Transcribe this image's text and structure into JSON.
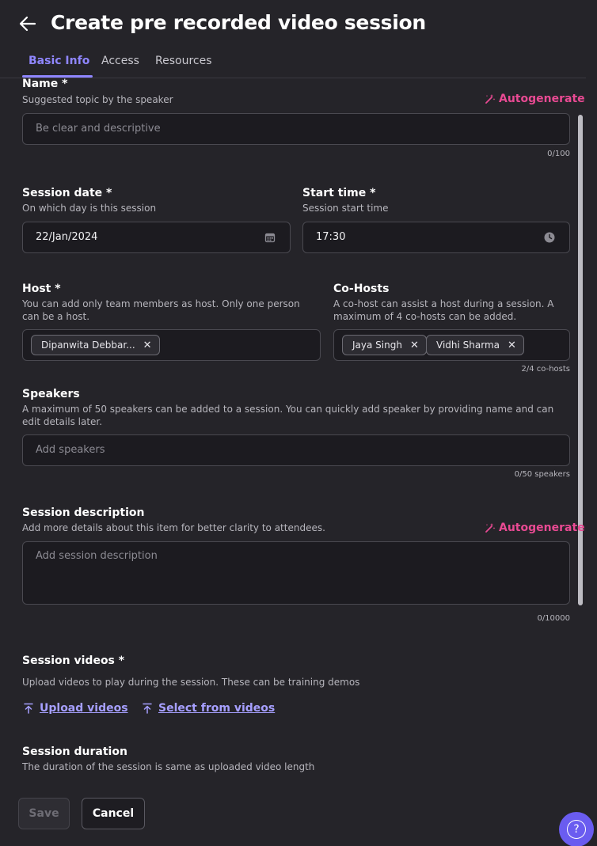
{
  "header": {
    "title": "Create pre recorded video session",
    "back_icon": "arrow-left-icon"
  },
  "tabs": [
    {
      "label": "Basic Info",
      "active": true
    },
    {
      "label": "Access",
      "active": false
    },
    {
      "label": "Resources",
      "active": false
    }
  ],
  "name": {
    "label": "Name *",
    "help": "Suggested topic by the speaker",
    "autogenerate": "Autogenerate",
    "placeholder": "Be clear and descriptive",
    "counter": "0/100"
  },
  "session_date": {
    "label": "Session date *",
    "help": "On which day is this session",
    "value": "22/Jan/2024",
    "icon": "calendar-icon"
  },
  "start_time": {
    "label": "Start time *",
    "help": "Session start time",
    "value": "17:30",
    "icon": "clock-icon"
  },
  "host": {
    "label": "Host *",
    "help": "You can add only team members as host. Only one person can be a host.",
    "chips": [
      "Dipanwita Debbar..."
    ]
  },
  "co_hosts": {
    "label": "Co-Hosts",
    "help": "A co-host can assist a host during a session. A maximum of 4 co-hosts can be added.",
    "chips": [
      "Jaya Singh",
      "Vidhi Sharma"
    ],
    "counter": "2/4 co-hosts"
  },
  "speakers": {
    "label": "Speakers",
    "help": "A maximum of 50 speakers can be added to a session. You can quickly add speaker by providing name and can edit details later.",
    "placeholder": "Add speakers",
    "counter": "0/50 speakers"
  },
  "description": {
    "label": "Session description",
    "help": "Add more details about this item for better clarity to attendees.",
    "autogenerate": "Autogenerate",
    "placeholder": "Add session description",
    "counter": "0/10000"
  },
  "videos": {
    "label": "Session videos *",
    "help": "Upload videos to play during the session. These can be training demos",
    "upload_label": "Upload videos",
    "select_label": "Select from videos"
  },
  "duration": {
    "label": "Session duration",
    "help": "The duration of the session is same as uploaded video length"
  },
  "actions": {
    "save_label": "Save",
    "cancel_label": "Cancel"
  },
  "help_fab": {
    "label": "?"
  },
  "colors": {
    "background": "#252429",
    "accent": "#8f86ff",
    "autogenerate": "#e94a93",
    "fab": "#6a5cf0"
  }
}
